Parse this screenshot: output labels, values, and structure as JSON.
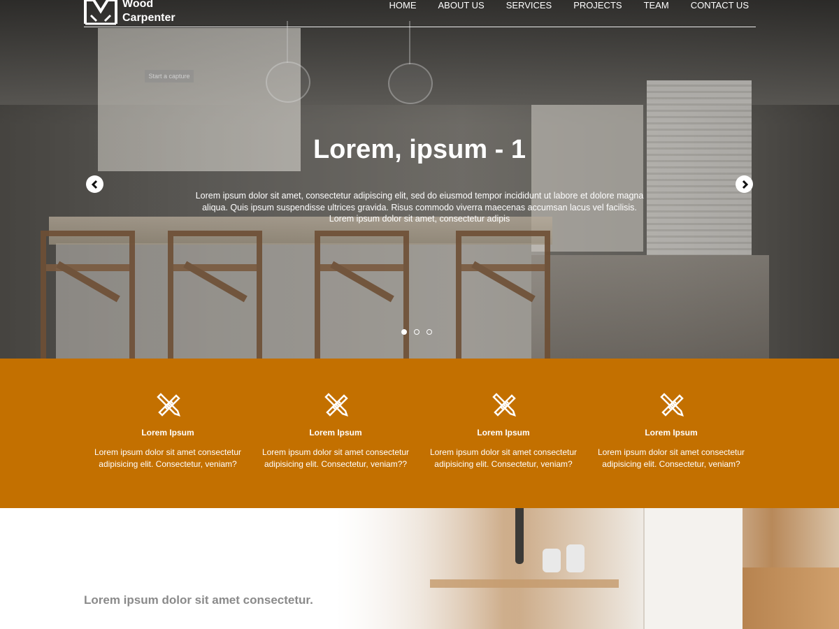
{
  "brand": {
    "line1": "Wood",
    "line2": "Carpenter"
  },
  "nav": {
    "items": [
      "HOME",
      "ABOUT US",
      "SERVICES",
      "PROJECTS",
      "TEAM",
      "CONTACT US"
    ]
  },
  "tooltip": "Start a capture",
  "hero": {
    "title": "Lorem, ipsum - 1",
    "text": "Lorem ipsum dolor sit amet, consectetur adipiscing elit, sed do eiusmod tempor incididunt ut labore et dolore magna aliqua. Quis ipsum suspendisse ultrices gravida. Risus commodo viverra maecenas accumsan lacus vel facilisis. Lorem ipsum dolor sit amet, consectetur adipis",
    "slides_total": 3,
    "active_slide": 1
  },
  "features": [
    {
      "title": "Lorem Ipsum",
      "text": "Lorem ipsum dolor sit amet consectetur adipisicing elit. Consectetur, veniam?"
    },
    {
      "title": "Lorem Ipsum",
      "text": "Lorem ipsum dolor sit amet consectetur adipisicing elit. Consectetur, veniam??"
    },
    {
      "title": "Lorem Ipsum",
      "text": "Lorem ipsum dolor sit amet consectetur adipisicing elit. Consectetur, veniam?"
    },
    {
      "title": "Lorem Ipsum",
      "text": "Lorem ipsum dolor sit amet consectetur adipisicing elit. Consectetur, veniam?"
    }
  ],
  "section": {
    "title": "Lorem ipsum dolor sit amet consectetur."
  },
  "colors": {
    "accent": "#c37000",
    "text_light": "#ffffff",
    "muted": "#8a8a8a"
  },
  "icons": {
    "feature": "pencil-ruler-icon",
    "prev": "chevron-left-icon",
    "next": "chevron-right-icon",
    "logo": "wood-carpenter-logo-icon"
  }
}
